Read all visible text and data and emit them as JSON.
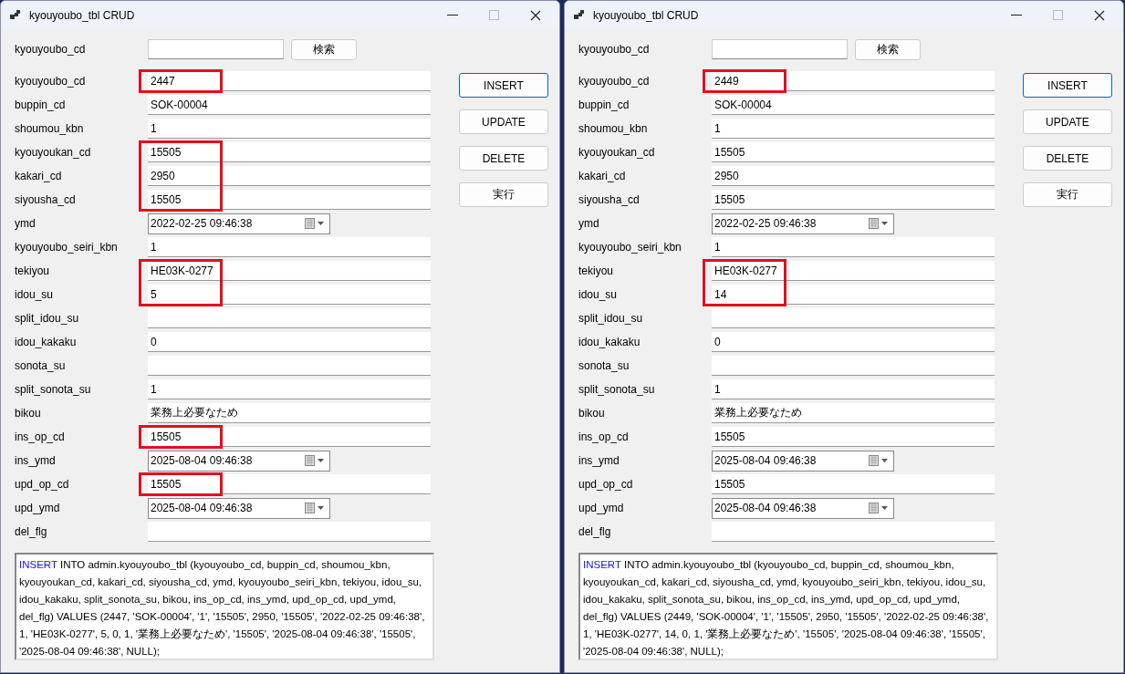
{
  "windows": [
    {
      "title": "kyouyoubo_tbl CRUD",
      "search": {
        "label": "kyouyoubo_cd",
        "button": "検索"
      },
      "fields": [
        {
          "label": "kyouyoubo_cd",
          "kind": "text",
          "value": "2447",
          "highlighted": true
        },
        {
          "label": "buppin_cd",
          "kind": "text",
          "value": "SOK-00004",
          "highlighted": false
        },
        {
          "label": "shoumou_kbn",
          "kind": "text",
          "value": "1",
          "highlighted": false
        },
        {
          "label": "kyouyoukan_cd",
          "kind": "text",
          "value": "15505",
          "highlighted": true
        },
        {
          "label": "kakari_cd",
          "kind": "text",
          "value": "2950",
          "highlighted": true
        },
        {
          "label": "siyousha_cd",
          "kind": "text",
          "value": "15505",
          "highlighted": true
        },
        {
          "label": "ymd",
          "kind": "date",
          "value": "2022-02-25 09:46:38",
          "highlighted": false
        },
        {
          "label": "kyouyoubo_seiri_kbn",
          "kind": "text",
          "value": "1",
          "highlighted": false
        },
        {
          "label": "tekiyou",
          "kind": "text",
          "value": "HE03K-0277",
          "highlighted": true
        },
        {
          "label": "idou_su",
          "kind": "text",
          "value": "5",
          "highlighted": true
        },
        {
          "label": "split_idou_su",
          "kind": "text",
          "highlighted": false
        },
        {
          "label": "idou_kakaku",
          "kind": "text",
          "value": "0",
          "highlighted": false
        },
        {
          "label": "sonota_su",
          "kind": "text",
          "highlighted": false
        },
        {
          "label": "split_sonota_su",
          "kind": "text",
          "value": "1",
          "highlighted": false
        },
        {
          "label": "bikou",
          "kind": "text",
          "value": "業務上必要なため",
          "highlighted": false
        },
        {
          "label": "ins_op_cd",
          "kind": "text",
          "value": "15505",
          "highlighted": true
        },
        {
          "label": "ins_ymd",
          "kind": "date",
          "value": "2025-08-04 09:46:38",
          "highlighted": false
        },
        {
          "label": "upd_op_cd",
          "kind": "text",
          "value": "15505",
          "highlighted": true
        },
        {
          "label": "upd_ymd",
          "kind": "date",
          "value": "2025-08-04 09:46:38",
          "highlighted": false
        },
        {
          "label": "del_flg",
          "kind": "text",
          "highlighted": false
        }
      ],
      "buttons": [
        {
          "label": "INSERT",
          "focused": true
        },
        {
          "label": "UPDATE",
          "focused": false
        },
        {
          "label": "DELETE",
          "focused": false
        },
        {
          "label": "実行",
          "focused": false
        }
      ],
      "sql": [
        {
          "kind": "keyword",
          "text": "INSERT"
        },
        {
          "kind": "plain",
          "text": "INTO admin.kyouyoubo_tbl (kyouyoubo_cd, buppin_cd, shoumou_kbn, kyouyoukan_cd, kakari_cd, siyousha_cd, ymd, kyouyoubo_seiri_kbn, tekiyou, idou_su, idou_kakaku, split_sonota_su, bikou, ins_op_cd, ins_ymd, upd_op_cd, upd_ymd, del_flg) VALUES (2447, 'SOK-00004', '1', '15505', 2950, '15505', '2022-02-25 09:46:38', 1, 'HE03K-0277', 5, 0, 1, '業務上必要なため', '15505', '2025-08-04 09:46:38', '15505', '2025-08-04 09:46:38', NULL);"
        }
      ]
    },
    {
      "title": "kyouyoubo_tbl CRUD",
      "search": {
        "label": "kyouyoubo_cd",
        "button": "検索"
      },
      "fields": [
        {
          "label": "kyouyoubo_cd",
          "kind": "text",
          "value": "2449",
          "highlighted": true
        },
        {
          "label": "buppin_cd",
          "kind": "text",
          "value": "SOK-00004",
          "highlighted": false
        },
        {
          "label": "shoumou_kbn",
          "kind": "text",
          "value": "1",
          "highlighted": false
        },
        {
          "label": "kyouyoukan_cd",
          "kind": "text",
          "value": "15505",
          "highlighted": false
        },
        {
          "label": "kakari_cd",
          "kind": "text",
          "value": "2950",
          "highlighted": false
        },
        {
          "label": "siyousha_cd",
          "kind": "text",
          "value": "15505",
          "highlighted": false
        },
        {
          "label": "ymd",
          "kind": "date",
          "value": "2022-02-25 09:46:38",
          "highlighted": false
        },
        {
          "label": "kyouyoubo_seiri_kbn",
          "kind": "text",
          "value": "1",
          "highlighted": false
        },
        {
          "label": "tekiyou",
          "kind": "text",
          "value": "HE03K-0277",
          "highlighted": true
        },
        {
          "label": "idou_su",
          "kind": "text",
          "value": "14",
          "highlighted": true
        },
        {
          "label": "split_idou_su",
          "kind": "text",
          "highlighted": false
        },
        {
          "label": "idou_kakaku",
          "kind": "text",
          "value": "0",
          "highlighted": false
        },
        {
          "label": "sonota_su",
          "kind": "text",
          "highlighted": false
        },
        {
          "label": "split_sonota_su",
          "kind": "text",
          "value": "1",
          "highlighted": false
        },
        {
          "label": "bikou",
          "kind": "text",
          "value": "業務上必要なため",
          "highlighted": false
        },
        {
          "label": "ins_op_cd",
          "kind": "text",
          "value": "15505",
          "highlighted": false
        },
        {
          "label": "ins_ymd",
          "kind": "date",
          "value": "2025-08-04 09:46:38",
          "highlighted": false
        },
        {
          "label": "upd_op_cd",
          "kind": "text",
          "value": "15505",
          "highlighted": false
        },
        {
          "label": "upd_ymd",
          "kind": "date",
          "value": "2025-08-04 09:46:38",
          "highlighted": false
        },
        {
          "label": "del_flg",
          "kind": "text",
          "highlighted": false
        }
      ],
      "buttons": [
        {
          "label": "INSERT",
          "focused": true
        },
        {
          "label": "UPDATE",
          "focused": false
        },
        {
          "label": "DELETE",
          "focused": false
        },
        {
          "label": "実行",
          "focused": false
        }
      ],
      "sql": [
        {
          "kind": "keyword",
          "text": "INSERT"
        },
        {
          "kind": "plain",
          "text": "INTO admin.kyouyoubo_tbl (kyouyoubo_cd, buppin_cd, shoumou_kbn, kyouyoukan_cd, kakari_cd, siyousha_cd, ymd, kyouyoubo_seiri_kbn, tekiyou, idou_su, idou_kakaku, split_sonota_su, bikou, ins_op_cd, ins_ymd, upd_op_cd, upd_ymd, del_flg) VALUES (2449, 'SOK-00004', '1', '15505', 2950, '15505', '2022-02-25 09:46:38', 1, 'HE03K-0277', 14, 0, 1, '業務上必要なため', '15505', '2025-08-04 09:46:38', '15505', '2025-08-04 09:46:38', NULL);"
        }
      ]
    }
  ]
}
